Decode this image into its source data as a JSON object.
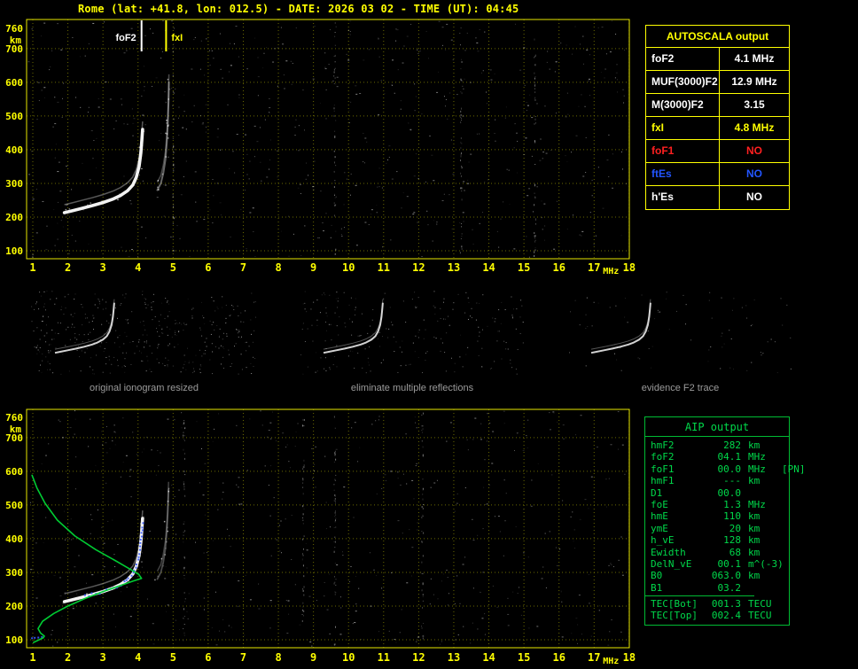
{
  "header": {
    "title": "Rome (lat: +41.8, lon: 012.5) - DATE: 2026 03 02 - TIME (UT): 04:45"
  },
  "colors": {
    "accent_yellow": "#ffff00",
    "accent_green": "#00d84a",
    "alert_red": "#ff2020",
    "info_blue": "#2255ff",
    "trace_white": "#ffffff",
    "grid_olive": "#6a6a00",
    "caption_gray": "#9b9b9b"
  },
  "autoscala_table": {
    "title": "AUTOSCALA output",
    "rows": [
      {
        "label": "foF2",
        "value": "4.1 MHz",
        "color": "#ffffff"
      },
      {
        "label": "MUF(3000)F2",
        "value": "12.9 MHz",
        "color": "#ffffff"
      },
      {
        "label": "M(3000)F2",
        "value": "3.15",
        "color": "#ffffff"
      },
      {
        "label": "fxI",
        "value": "4.8 MHz",
        "color": "#ffff00"
      },
      {
        "label": "foF1",
        "value": "NO",
        "color": "#ff2020"
      },
      {
        "label": "ftEs",
        "value": "NO",
        "color": "#2255ff"
      },
      {
        "label": "h'Es",
        "value": "NO",
        "color": "#ffffff"
      }
    ]
  },
  "thumbnails": [
    {
      "caption": "original ionogram resized"
    },
    {
      "caption": "eliminate multiple reflections"
    },
    {
      "caption": "evidence F2 trace"
    }
  ],
  "aip_table": {
    "title": "AIP output",
    "rows": [
      {
        "param": "hmF2",
        "value": "282",
        "unit": "km",
        "note": ""
      },
      {
        "param": "foF2",
        "value": "04.1",
        "unit": "MHz",
        "note": ""
      },
      {
        "param": "foF1",
        "value": "00.0",
        "unit": "MHz",
        "note": "[PN]"
      },
      {
        "param": "hmF1",
        "value": "---",
        "unit": "km",
        "note": ""
      },
      {
        "param": "D1",
        "value": "00.0",
        "unit": "",
        "note": ""
      },
      {
        "param": "foE",
        "value": "1.3",
        "unit": "MHz",
        "note": ""
      },
      {
        "param": "hmE",
        "value": "110",
        "unit": "km",
        "note": ""
      },
      {
        "param": "ymE",
        "value": "20",
        "unit": "km",
        "note": ""
      },
      {
        "param": "h_vE",
        "value": "128",
        "unit": "km",
        "note": ""
      },
      {
        "param": "Ewidth",
        "value": "68",
        "unit": "km",
        "note": ""
      },
      {
        "param": "DelN_vE",
        "value": "00.1",
        "unit": "m^(-3)",
        "note": ""
      },
      {
        "param": "B0",
        "value": "063.0",
        "unit": "km",
        "note": ""
      },
      {
        "param": "B1",
        "value": "03.2",
        "unit": "",
        "note": ""
      }
    ],
    "tec_rows": [
      {
        "param": "TEC[Bot]",
        "value": "001.3",
        "unit": "TECU"
      },
      {
        "param": "TEC[Top]",
        "value": "002.4",
        "unit": "TECU"
      }
    ]
  },
  "chart_data": [
    {
      "id": "ionogram_top",
      "type": "scatter",
      "title": "scaled ionogram with AUTOSCALA markers",
      "xlabel": "MHz",
      "ylabel": "km",
      "xlim": [
        1,
        18
      ],
      "ylim": [
        100,
        760
      ],
      "xticks": [
        1,
        2,
        3,
        4,
        5,
        6,
        7,
        8,
        9,
        10,
        11,
        12,
        13,
        14,
        15,
        16,
        17,
        18
      ],
      "yticks": [
        100,
        200,
        300,
        400,
        500,
        600,
        700,
        760
      ],
      "grid": true,
      "markers": [
        {
          "label": "foF2",
          "x": 4.1,
          "color": "#ffffff",
          "label_side": "left"
        },
        {
          "label": "fxI",
          "x": 4.8,
          "color": "#ffff00",
          "label_side": "right"
        }
      ],
      "rfi_lines_mhz": [
        5.0,
        9.6,
        13.2,
        15.3
      ],
      "series": [
        {
          "name": "F2-trace-ordinary",
          "style": "trace",
          "color": "#ffffff",
          "width": 3.6,
          "opacity": 0.95,
          "points": [
            [
              1.9,
              213
            ],
            [
              2.1,
              218
            ],
            [
              2.4,
              226
            ],
            [
              2.7,
              234
            ],
            [
              3.0,
              243
            ],
            [
              3.3,
              254
            ],
            [
              3.5,
              264
            ],
            [
              3.7,
              278
            ],
            [
              3.85,
              295
            ],
            [
              3.95,
              318
            ],
            [
              4.03,
              350
            ],
            [
              4.08,
              390
            ],
            [
              4.11,
              430
            ],
            [
              4.13,
              460
            ]
          ]
        },
        {
          "name": "F2-trace-extraordinary",
          "style": "trace",
          "color": "#cccccc",
          "width": 2.0,
          "opacity": 0.5,
          "points": [
            [
              4.55,
              280
            ],
            [
              4.65,
              300
            ],
            [
              4.72,
              330
            ],
            [
              4.78,
              370
            ],
            [
              4.82,
              420
            ],
            [
              4.85,
              480
            ],
            [
              4.87,
              545
            ],
            [
              4.88,
              600
            ]
          ]
        }
      ]
    },
    {
      "id": "ionogram_bottom",
      "type": "scatter",
      "title": "ionogram with fitted trace and electron density profile",
      "xlabel": "MHz",
      "ylabel": "km",
      "xlim": [
        1,
        18
      ],
      "ylim": [
        100,
        760
      ],
      "xticks": [
        1,
        2,
        3,
        4,
        5,
        6,
        7,
        8,
        9,
        10,
        11,
        12,
        13,
        14,
        15,
        16,
        17,
        18
      ],
      "yticks": [
        100,
        200,
        300,
        400,
        500,
        600,
        700,
        760
      ],
      "grid": true,
      "rfi_lines_mhz": [
        5.3,
        8.7,
        9.6,
        12.1
      ],
      "series": [
        {
          "name": "F2-trace-ordinary",
          "style": "trace",
          "color": "#ffffff",
          "width": 3.6,
          "opacity": 0.95,
          "points": [
            [
              1.9,
              213
            ],
            [
              2.1,
              218
            ],
            [
              2.4,
              226
            ],
            [
              2.7,
              234
            ],
            [
              3.0,
              243
            ],
            [
              3.3,
              254
            ],
            [
              3.5,
              264
            ],
            [
              3.7,
              278
            ],
            [
              3.85,
              295
            ],
            [
              3.95,
              318
            ],
            [
              4.03,
              350
            ],
            [
              4.08,
              390
            ],
            [
              4.11,
              430
            ],
            [
              4.13,
              460
            ]
          ]
        },
        {
          "name": "F2-trace-extraordinary",
          "style": "trace",
          "color": "#bbbbbb",
          "width": 1.8,
          "opacity": 0.4,
          "points": [
            [
              4.55,
              280
            ],
            [
              4.65,
              300
            ],
            [
              4.72,
              330
            ],
            [
              4.78,
              370
            ],
            [
              4.82,
              420
            ],
            [
              4.85,
              480
            ],
            [
              4.87,
              545
            ]
          ]
        },
        {
          "name": "fitted-F2-trace",
          "style": "dots",
          "color": "#3a5bff",
          "points": [
            [
              2.5,
              229
            ],
            [
              2.8,
              237
            ],
            [
              3.1,
              246
            ],
            [
              3.4,
              258
            ],
            [
              3.6,
              270
            ],
            [
              3.8,
              288
            ],
            [
              3.95,
              315
            ],
            [
              4.05,
              355
            ],
            [
              4.1,
              405
            ],
            [
              4.12,
              445
            ]
          ]
        },
        {
          "name": "fitted-E-trace",
          "style": "dots",
          "color": "#3a5bff",
          "points": [
            [
              0.98,
              102
            ],
            [
              1.08,
              104
            ],
            [
              1.18,
              107
            ],
            [
              1.28,
              110
            ]
          ]
        },
        {
          "name": "electron-density-profile",
          "style": "line",
          "color": "#00cc33",
          "points": [
            [
              1.02,
              92
            ],
            [
              1.18,
              100
            ],
            [
              1.3,
              106
            ],
            [
              1.33,
              111
            ],
            [
              1.22,
              120
            ],
            [
              1.15,
              133
            ],
            [
              1.28,
              155
            ],
            [
              1.6,
              178
            ],
            [
              2.0,
              200
            ],
            [
              2.5,
              223
            ],
            [
              3.0,
              243
            ],
            [
              3.5,
              261
            ],
            [
              3.85,
              274
            ],
            [
              4.1,
              282
            ],
            [
              4.02,
              294
            ],
            [
              3.75,
              311
            ],
            [
              3.35,
              335
            ],
            [
              2.8,
              367
            ],
            [
              2.2,
              408
            ],
            [
              1.7,
              455
            ],
            [
              1.35,
              505
            ],
            [
              1.12,
              550
            ],
            [
              0.98,
              588
            ]
          ]
        }
      ]
    }
  ]
}
